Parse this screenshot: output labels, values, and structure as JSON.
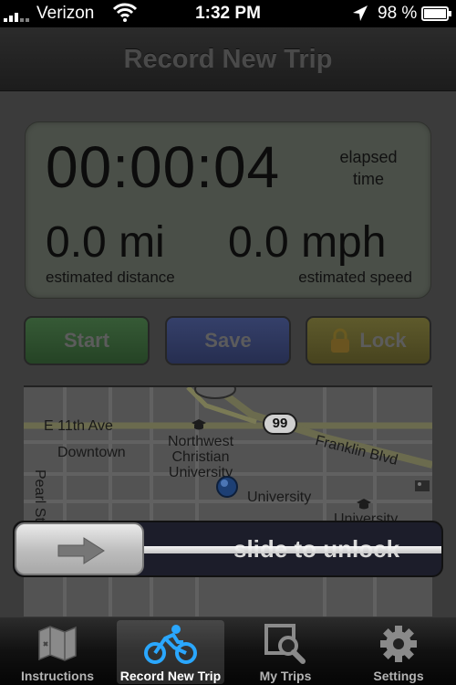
{
  "status_bar": {
    "carrier": "Verizon",
    "time": "1:32 PM",
    "battery_percent": "98 %"
  },
  "nav": {
    "title": "Record New Trip"
  },
  "trip": {
    "elapsed_time": "00:00:04",
    "elapsed_label_line1": "elapsed",
    "elapsed_label_line2": "time",
    "distance_value": "0.0 mi",
    "distance_label": "estimated distance",
    "speed_value": "0.0 mph",
    "speed_label": "estimated speed"
  },
  "buttons": {
    "start": "Start",
    "save": "Save",
    "lock": "Lock"
  },
  "map": {
    "labels": {
      "e11th": "E 11th Ave",
      "downtown": "Downtown",
      "ncu_1": "Northwest",
      "ncu_2": "Christian",
      "ncu_3": "University",
      "university": "University",
      "franklin": "Franklin Blvd",
      "pearl": "Pearl St",
      "univ2": "University",
      "hwy": "99"
    }
  },
  "lock_slider": {
    "text": "slide to unlock"
  },
  "tabs": [
    {
      "label": "Instructions",
      "icon": "map-icon"
    },
    {
      "label": "Record New Trip",
      "icon": "bicycle-icon"
    },
    {
      "label": "My Trips",
      "icon": "magnifier-icon"
    },
    {
      "label": "Settings",
      "icon": "gear-icon"
    }
  ],
  "colors": {
    "start_button": "#365a36",
    "save_button": "#35406a",
    "lock_button": "#5e5a2c",
    "active_tab_icon": "#2aa7ff"
  }
}
